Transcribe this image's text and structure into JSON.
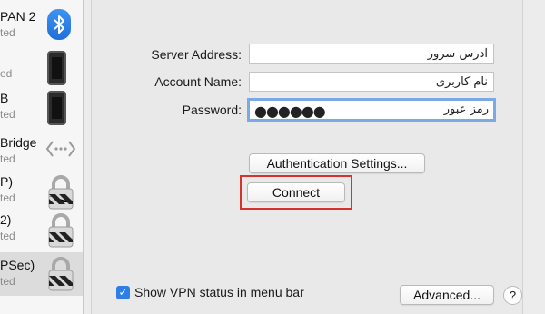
{
  "sidebar": {
    "services": [
      {
        "name": "PAN 2",
        "status": "ted",
        "icon": "bluetooth-icon"
      },
      {
        "name": "",
        "status": "ed",
        "icon": "iphone-icon"
      },
      {
        "name": "B",
        "status": "ted",
        "icon": "iphone-icon"
      },
      {
        "name": "Bridge",
        "status": "ted",
        "icon": "bridge-icon"
      },
      {
        "name": "P)",
        "status": "ted",
        "icon": "vpn-lock-icon"
      },
      {
        "name": "2)",
        "status": "ted",
        "icon": "vpn-lock-icon"
      },
      {
        "name": "PSec)",
        "status": "ted",
        "icon": "vpn-lock-icon",
        "selected": true
      }
    ]
  },
  "form": {
    "server_label": "Server Address:",
    "server_value": "آدرس سرور",
    "account_label": "Account Name:",
    "account_value": "نام کاربری",
    "password_label": "Password:",
    "password_dots": "●●●●●●",
    "password_value": "رمز عبور"
  },
  "buttons": {
    "auth_settings": "Authentication Settings...",
    "connect": "Connect",
    "advanced": "Advanced...",
    "help": "?"
  },
  "footer": {
    "show_vpn_checked": true,
    "show_vpn_label": "Show VPN status in menu bar"
  },
  "colors": {
    "highlight": "#d8322c",
    "focus_ring": "#7aa9e6",
    "checkbox": "#2f7ee6"
  }
}
